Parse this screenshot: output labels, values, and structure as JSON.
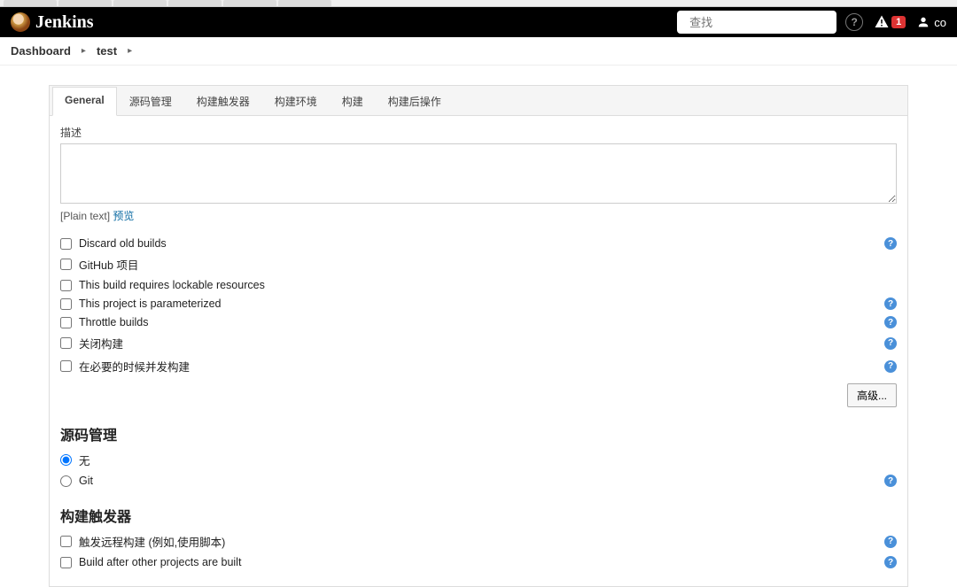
{
  "header": {
    "logo_text": "Jenkins",
    "search_placeholder": "查找",
    "alert_count": "1",
    "user_label": "co"
  },
  "breadcrumbs": [
    {
      "label": "Dashboard"
    },
    {
      "label": "test"
    }
  ],
  "tabs": [
    {
      "label": "General",
      "active": true
    },
    {
      "label": "源码管理"
    },
    {
      "label": "构建触发器"
    },
    {
      "label": "构建环境"
    },
    {
      "label": "构建"
    },
    {
      "label": "构建后操作"
    }
  ],
  "general": {
    "desc_label": "描述",
    "desc_value": "",
    "format_prefix": "[Plain text] ",
    "preview_label": "预览",
    "options": [
      {
        "label": "Discard old builds",
        "help": true
      },
      {
        "label": "GitHub 项目",
        "help": false
      },
      {
        "label": "This build requires lockable resources",
        "help": false
      },
      {
        "label": "This project is parameterized",
        "help": true
      },
      {
        "label": "Throttle builds",
        "help": true
      },
      {
        "label": "关闭构建",
        "help": true
      },
      {
        "label": "在必要的时候并发构建",
        "help": true
      }
    ],
    "advanced_label": "高级..."
  },
  "scm": {
    "title": "源码管理",
    "options": [
      {
        "label": "无",
        "checked": true,
        "help": false
      },
      {
        "label": "Git",
        "checked": false,
        "help": true
      }
    ]
  },
  "triggers": {
    "title": "构建触发器",
    "options": [
      {
        "label": "触发远程构建 (例如,使用脚本)",
        "help": true
      },
      {
        "label": "Build after other projects are built",
        "help": true
      }
    ]
  }
}
